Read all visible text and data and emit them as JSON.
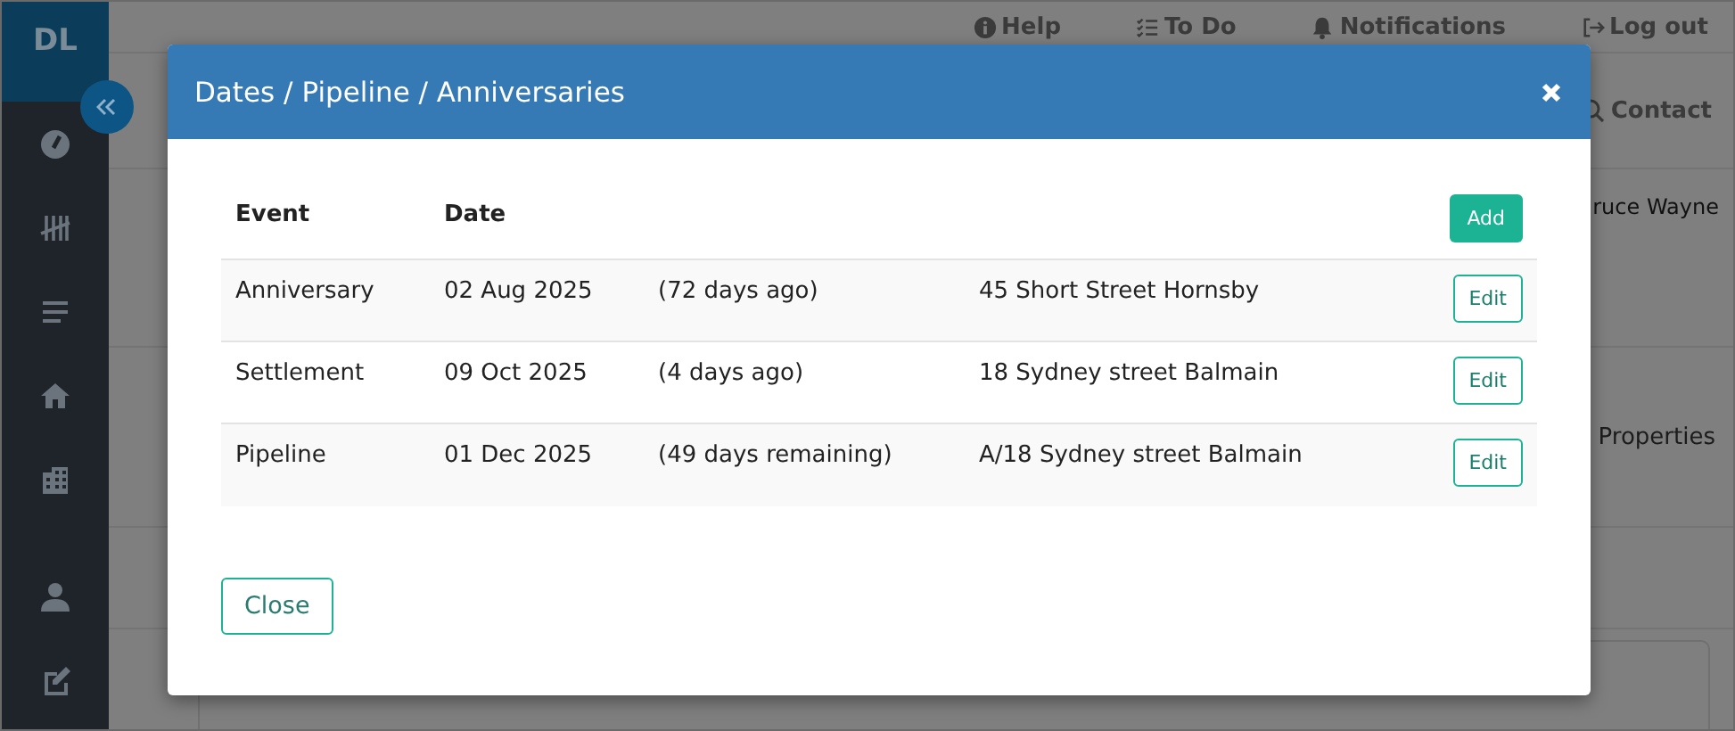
{
  "app": {
    "logo": "DL"
  },
  "top_nav": [
    {
      "label": "Help"
    },
    {
      "label": "To Do"
    },
    {
      "label": "Notifications"
    },
    {
      "label": "Log out"
    }
  ],
  "search": {
    "label": "Contact"
  },
  "background_texts": [
    "ruce Wayne",
    "Properties"
  ],
  "modal": {
    "title": "Dates / Pipeline / Anniversaries",
    "columns": [
      "Event",
      "Date"
    ],
    "add_button": "Add",
    "rows": [
      {
        "event": "Anniversary",
        "date": "02 Aug 2025",
        "relative": "(72 days ago)",
        "address": "45 Short Street Hornsby",
        "action": "Edit"
      },
      {
        "event": "Settlement",
        "date": "09 Oct 2025",
        "relative": "(4 days ago)",
        "address": "18 Sydney street Balmain",
        "action": "Edit"
      },
      {
        "event": "Pipeline",
        "date": "01 Dec 2025",
        "relative": "(49 days remaining)",
        "address": "A/18 Sydney street Balmain",
        "action": "Edit"
      }
    ],
    "close_button": "Close"
  }
}
